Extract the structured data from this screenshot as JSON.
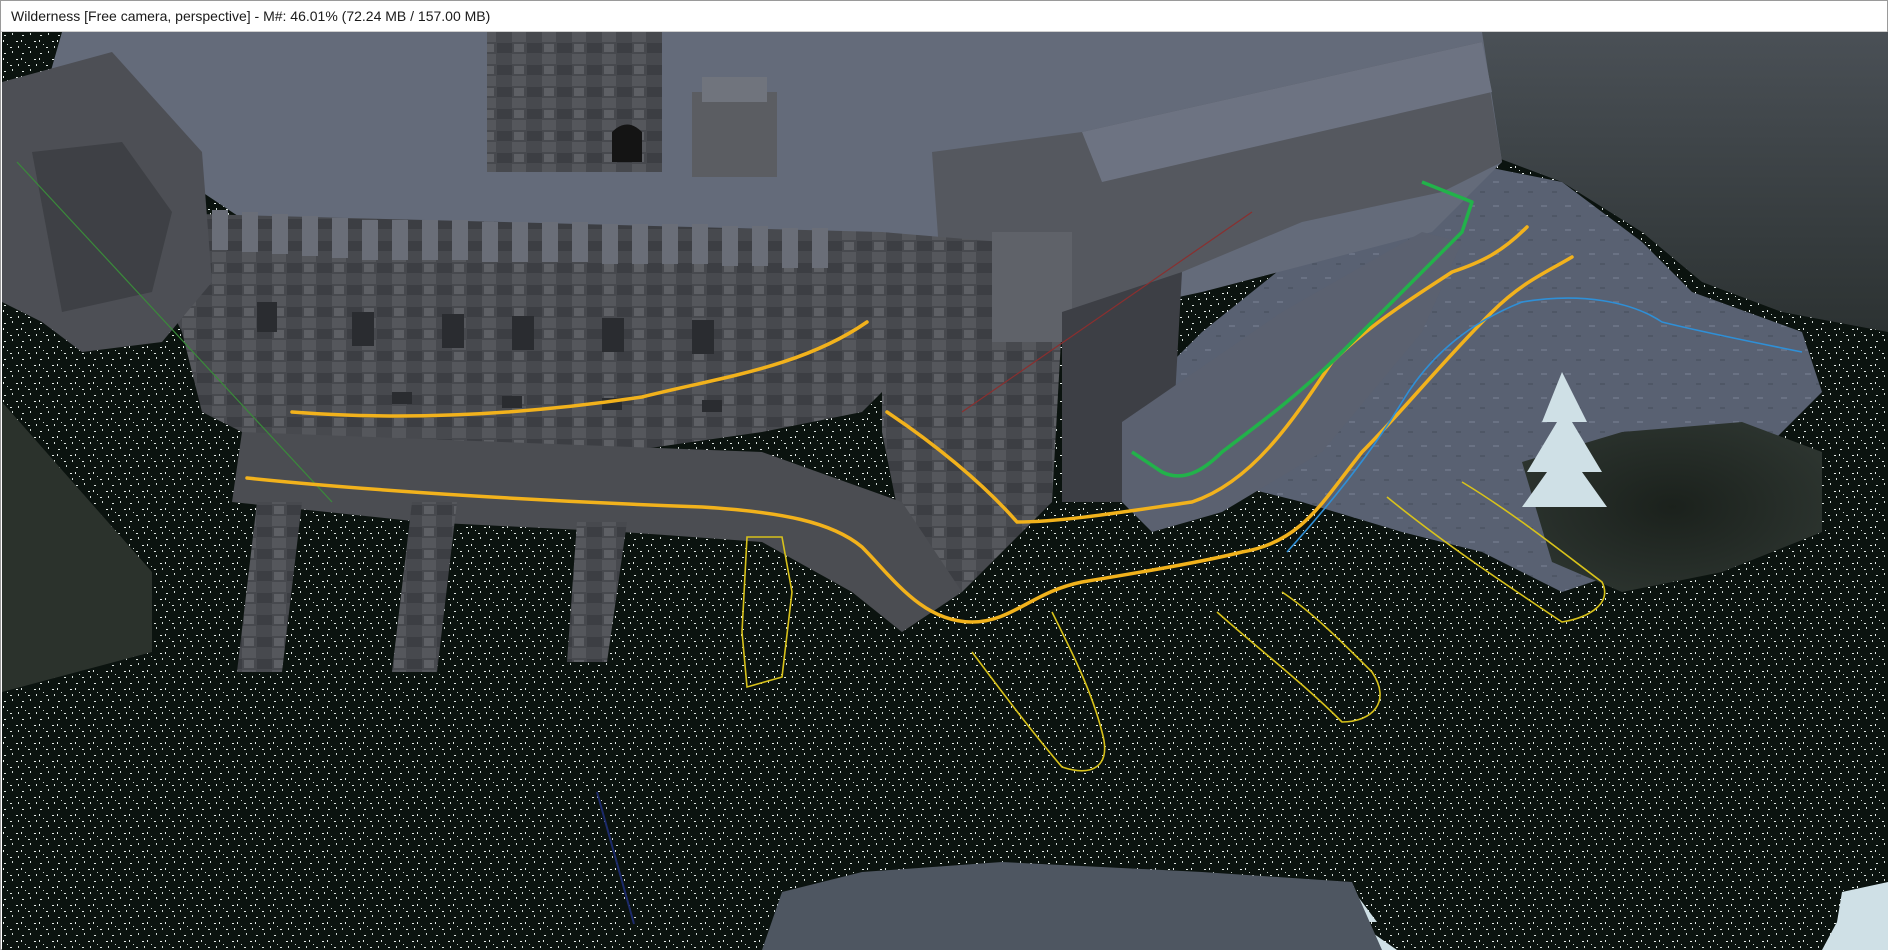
{
  "window": {
    "title": "Wilderness [Free camera, perspective] - M#: 46.01% (72.24 MB / 157.00 MB)"
  },
  "viewport": {
    "scene": "3d-render",
    "palette": {
      "water": "#0b130f",
      "snow": "#5a6270",
      "stone": "#4a4c52",
      "roof": "#6b7282",
      "path_orange": "#f2b21c",
      "path_thin_yellow": "#d8c21a",
      "path_green": "#22b24a",
      "path_blue": "#2f8fd6"
    },
    "icons": [
      "tree-icon"
    ]
  }
}
